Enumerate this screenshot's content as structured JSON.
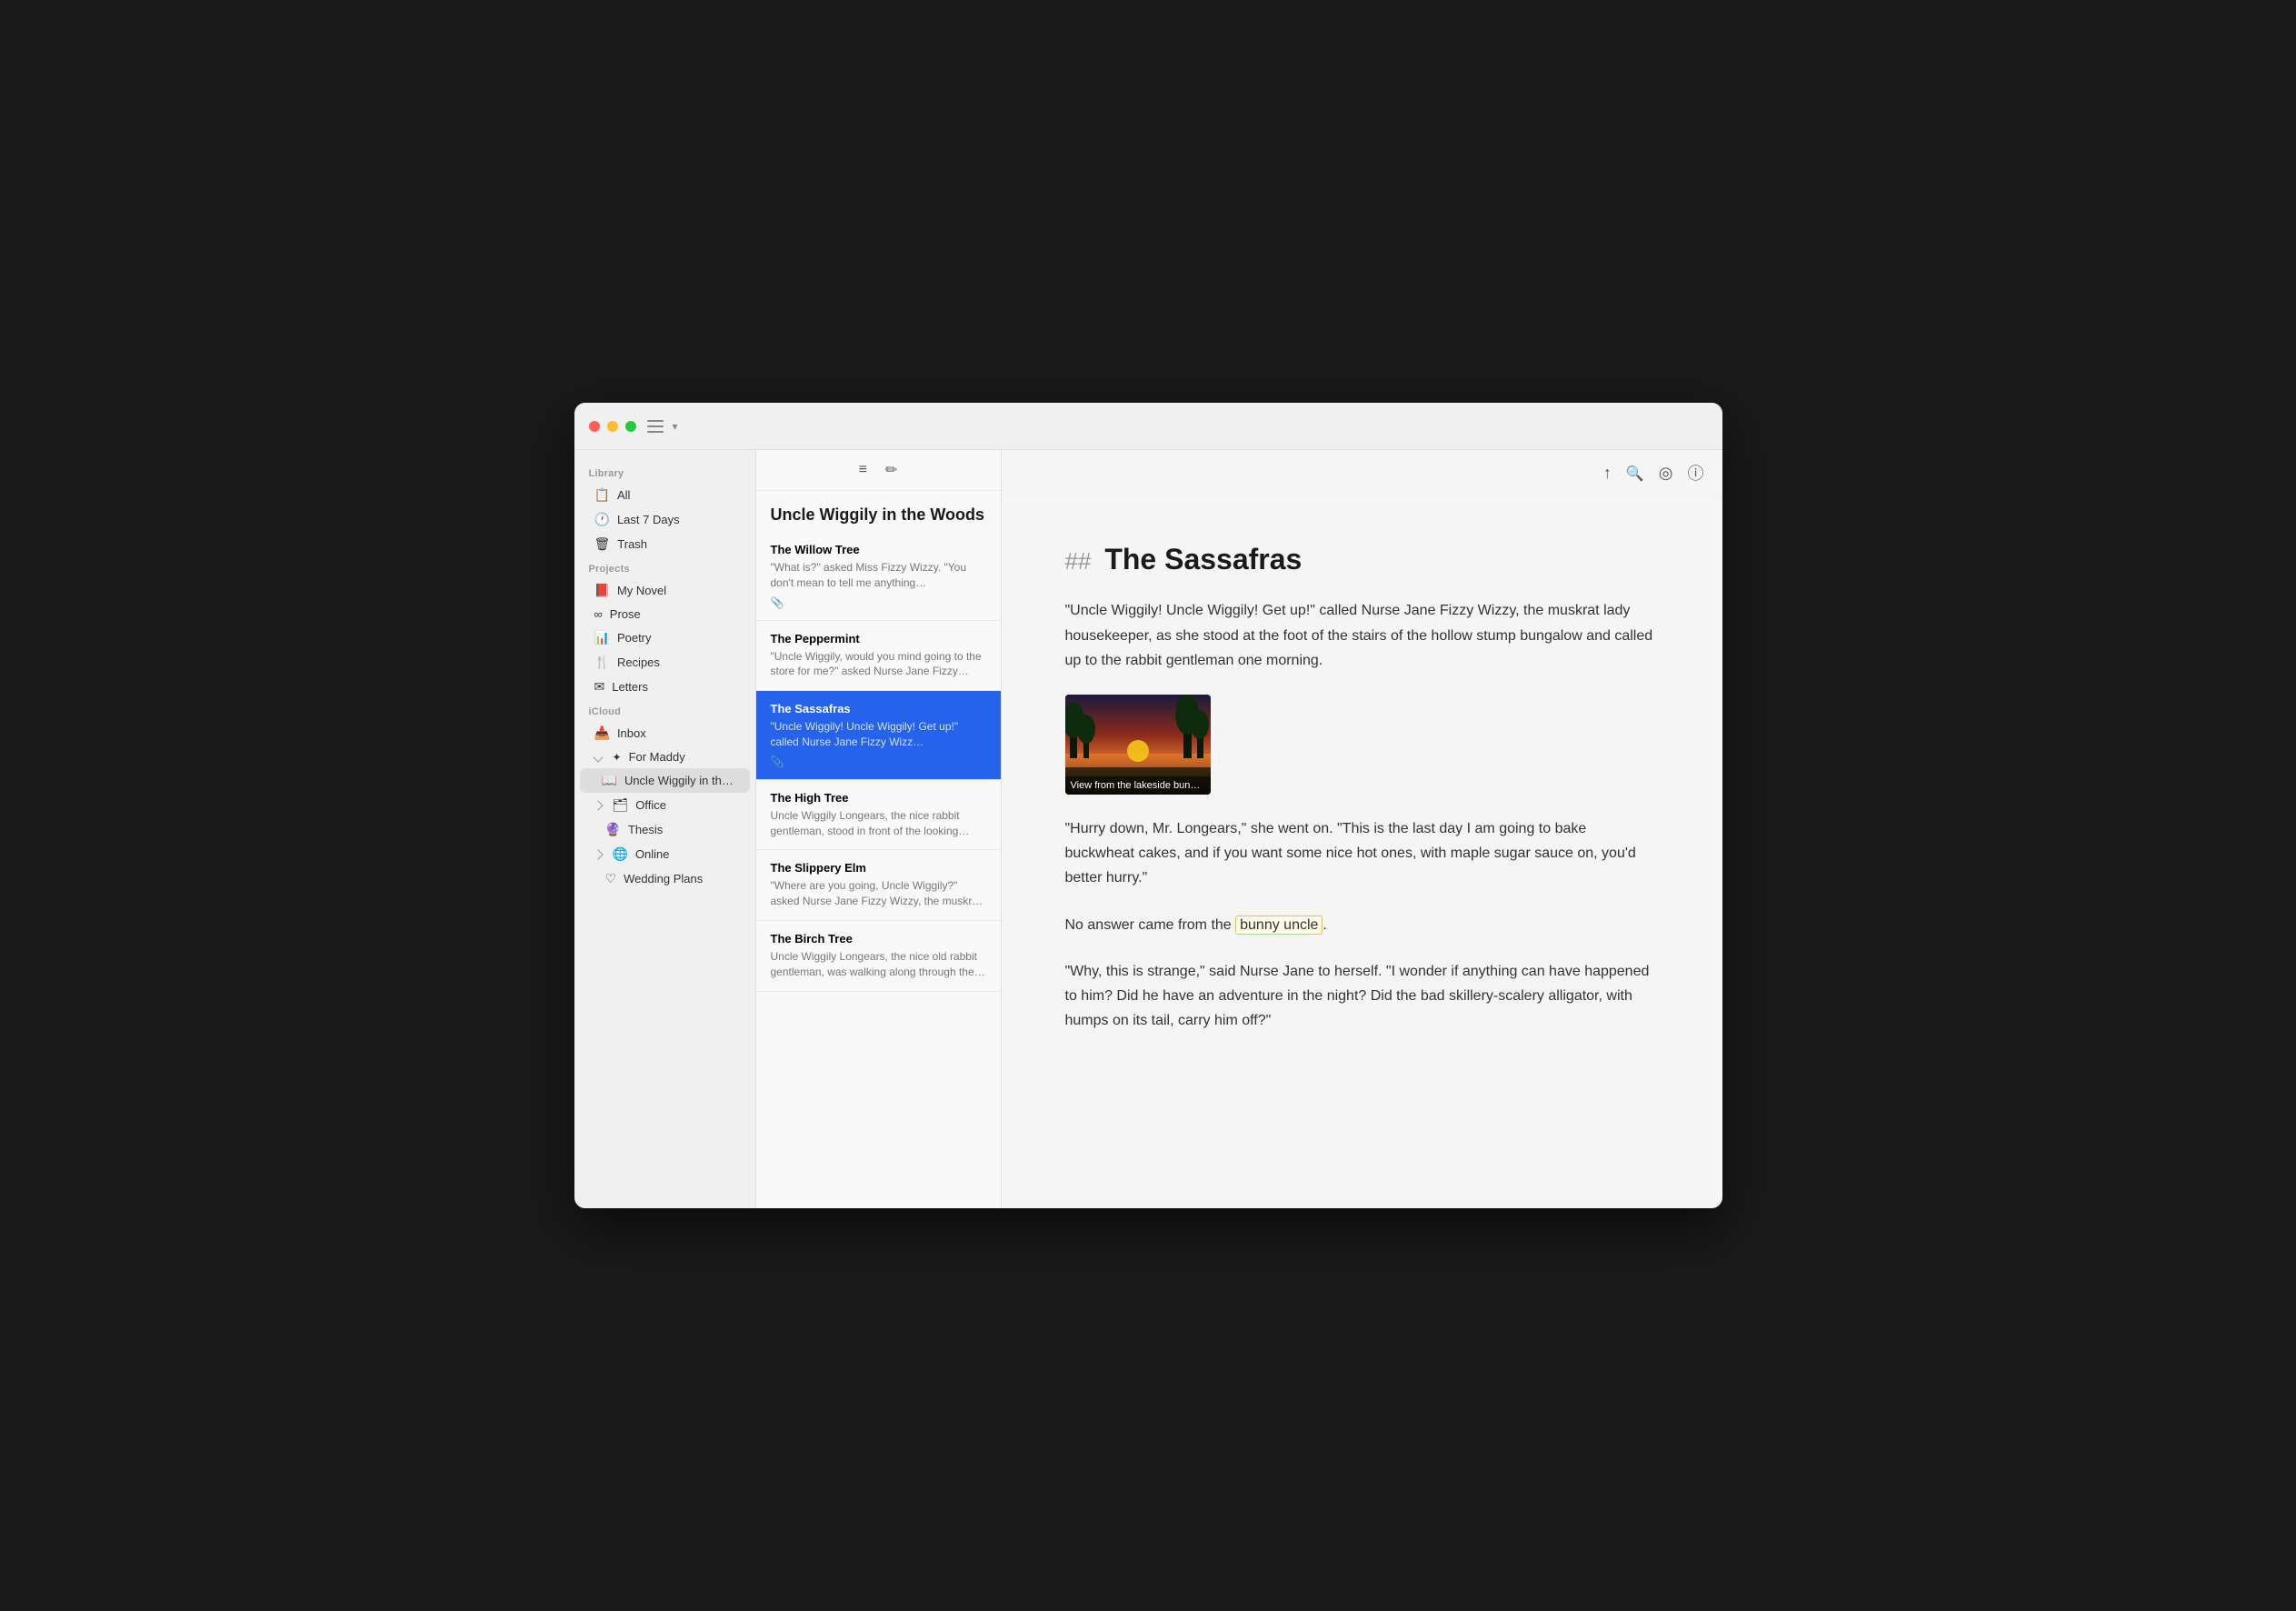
{
  "window": {
    "title": "Uncle Wiggily in the Woods"
  },
  "sidebar": {
    "library_label": "Library",
    "projects_label": "Projects",
    "icloud_label": "iCloud",
    "library_items": [
      {
        "id": "all",
        "icon": "📋",
        "label": "All"
      },
      {
        "id": "last7days",
        "icon": "🕐",
        "label": "Last 7 Days"
      },
      {
        "id": "trash",
        "icon": "🗑",
        "label": "Trash"
      }
    ],
    "project_items": [
      {
        "id": "mynovel",
        "icon": "📕",
        "label": "My Novel"
      },
      {
        "id": "prose",
        "icon": "∞",
        "label": "Prose"
      },
      {
        "id": "poetry",
        "icon": "📊",
        "label": "Poetry"
      },
      {
        "id": "recipes",
        "icon": "🍴",
        "label": "Recipes"
      },
      {
        "id": "letters",
        "icon": "✉",
        "label": "Letters"
      }
    ],
    "icloud_items": [
      {
        "id": "inbox",
        "icon": "📥",
        "label": "Inbox"
      },
      {
        "id": "formaddy",
        "icon": "✦",
        "label": "For Maddy",
        "expanded": true,
        "children": [
          {
            "id": "unclewiggily",
            "icon": "📖",
            "label": "Uncle Wiggily in th…"
          }
        ]
      },
      {
        "id": "office",
        "icon": "🗂",
        "label": "Office",
        "expandable": true
      },
      {
        "id": "thesis",
        "icon": "🔮",
        "label": "Thesis"
      },
      {
        "id": "online",
        "icon": "🌐",
        "label": "Online",
        "expandable": true
      },
      {
        "id": "weddingplans",
        "icon": "♡",
        "label": "Wedding Plans"
      }
    ]
  },
  "note_list": {
    "title": "Uncle Wiggily in the Woods",
    "notes": [
      {
        "id": "willowTree",
        "title": "The Willow Tree",
        "preview": "\"What is?\" asked Miss Fizzy Wizzy. \"You don't mean to tell me anything…",
        "attachment": true,
        "selected": false
      },
      {
        "id": "peppermint",
        "title": "The Peppermint",
        "preview": "\"Uncle Wiggily, would you mind going to the store for me?\" asked Nurse Jane Fizzy Wizzy, the muskr…",
        "attachment": false,
        "selected": false
      },
      {
        "id": "sassafras",
        "title": "The Sassafras",
        "preview": "\"Uncle Wiggily! Uncle Wiggily! Get up!\" called Nurse Jane Fizzy Wizz…",
        "attachment": true,
        "selected": true
      },
      {
        "id": "highTree",
        "title": "The High Tree",
        "preview": "Uncle Wiggily Longears, the nice rabbit gentleman, stood in front of the looking glass trying on a new…",
        "attachment": false,
        "selected": false
      },
      {
        "id": "slipperyElm",
        "title": "The Slippery Elm",
        "preview": "\"Where are you going, Uncle Wiggily?\" asked Nurse Jane Fizzy Wizzy, the muskrat lady housekee…",
        "attachment": false,
        "selected": false
      },
      {
        "id": "birchTree",
        "title": "The Birch Tree",
        "preview": "Uncle Wiggily Longears, the nice old rabbit gentleman, was walking along through the woods one afternoon w…",
        "attachment": false,
        "selected": false
      }
    ]
  },
  "editor": {
    "title_prefix": "##",
    "title": "The Sassafras",
    "paragraph1": "\"Uncle Wiggily! Uncle Wiggily! Get up!\" called Nurse Jane Fizzy Wizzy, the muskrat lady housekeeper, as she stood at the foot of the stairs of the hollow stump bungalow and called up to the rabbit gentleman one morning.",
    "image_caption": "View from the lakeside bun…",
    "paragraph2": "\"Hurry down, Mr. Longears,\" she went on. \"This is the last day I am going to bake buckwheat cakes, and if you want some nice hot ones, with maple sugar sauce on, you'd better hurry.\"",
    "paragraph3_before": "No answer came from the ",
    "highlight_text": "bunny uncle",
    "paragraph3_after": ".",
    "paragraph4": "\"Why, this is strange,\" said Nurse Jane to herself. \"I wonder if anything can have happened to him? Did he have an adventure in the night? Did the bad skillery-scalery alligator, with humps on its tail, carry him off?\""
  },
  "toolbar": {
    "share_icon": "↑",
    "search_icon": "🔍",
    "badge_icon": "◎",
    "info_icon": "ⓘ",
    "filter_icon": "≡",
    "compose_icon": "✏"
  }
}
